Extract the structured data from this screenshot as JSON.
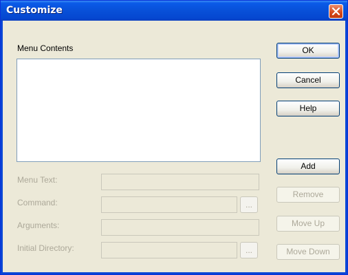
{
  "window": {
    "title": "Customize",
    "title_color": "#ffffff",
    "titlebar_color": "#0a5ae8"
  },
  "list": {
    "label": "Menu Contents",
    "items": []
  },
  "fields": {
    "menu_text": {
      "label": "Menu Text:",
      "value": ""
    },
    "command": {
      "label": "Command:",
      "value": "",
      "browse_label": "..."
    },
    "arguments": {
      "label": "Arguments:",
      "value": ""
    },
    "initial_directory": {
      "label": "Initial Directory:",
      "value": "",
      "browse_label": "..."
    }
  },
  "buttons": {
    "ok": "OK",
    "cancel": "Cancel",
    "help": "Help",
    "add": "Add",
    "remove": "Remove",
    "move_up": "Move Up",
    "move_down": "Move Down"
  },
  "icons": {
    "close": "close-icon"
  }
}
